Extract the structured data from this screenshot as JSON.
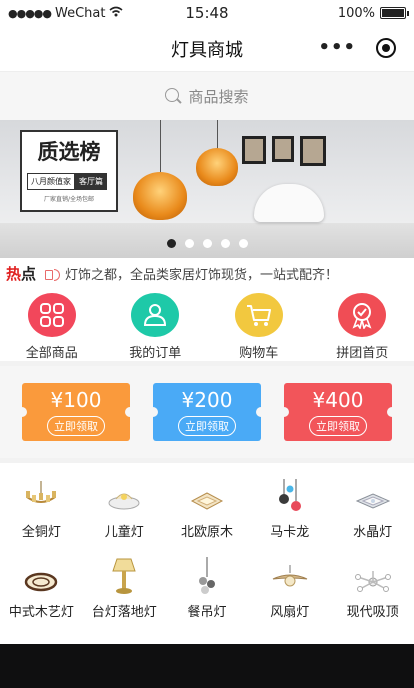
{
  "status_bar": {
    "carrier": "WeChat",
    "time": "15:48",
    "battery": "100%"
  },
  "header": {
    "title": "灯具商城"
  },
  "search": {
    "placeholder": "商品搜索"
  },
  "banner": {
    "headline": "质选榜",
    "tag_left": "八月颜值家",
    "tag_right": "客厅篇",
    "tagline": "厂家直销/全场包邮",
    "active_index": 0,
    "slide_count": 5
  },
  "news": {
    "hot_red": "热",
    "hot_black": "点",
    "text": "灯饰之都，全品类家居灯饰现货，一站式配齐！"
  },
  "quick_nav": [
    {
      "label": "全部商品",
      "icon": "grid-icon",
      "color": "#f2475b"
    },
    {
      "label": "我的订单",
      "icon": "user-icon",
      "color": "#1ec9a8"
    },
    {
      "label": "购物车",
      "icon": "cart-icon",
      "color": "#f2c83f"
    },
    {
      "label": "拼团首页",
      "icon": "badge-icon",
      "color": "#f04d55"
    }
  ],
  "coupons": [
    {
      "amount": "¥100",
      "action": "立即领取",
      "color": "#fa9a3c"
    },
    {
      "amount": "¥200",
      "action": "立即领取",
      "color": "#4aaaf6"
    },
    {
      "amount": "¥400",
      "action": "立即领取",
      "color": "#f2555a"
    }
  ],
  "categories": [
    {
      "label": "全铜灯",
      "icon": "chandelier-icon"
    },
    {
      "label": "儿童灯",
      "icon": "ceiling-lamp-icon"
    },
    {
      "label": "北欧原木",
      "icon": "panel-lamp-icon"
    },
    {
      "label": "马卡龙",
      "icon": "pendant-lamp-icon"
    },
    {
      "label": "水晶灯",
      "icon": "crystal-lamp-icon"
    },
    {
      "label": "中式木艺灯",
      "icon": "wooden-lamp-icon"
    },
    {
      "label": "台灯落地灯",
      "icon": "table-lamp-icon"
    },
    {
      "label": "餐吊灯",
      "icon": "dining-pendant-icon"
    },
    {
      "label": "风扇灯",
      "icon": "fan-lamp-icon"
    },
    {
      "label": "现代吸顶",
      "icon": "flush-mount-icon"
    }
  ]
}
